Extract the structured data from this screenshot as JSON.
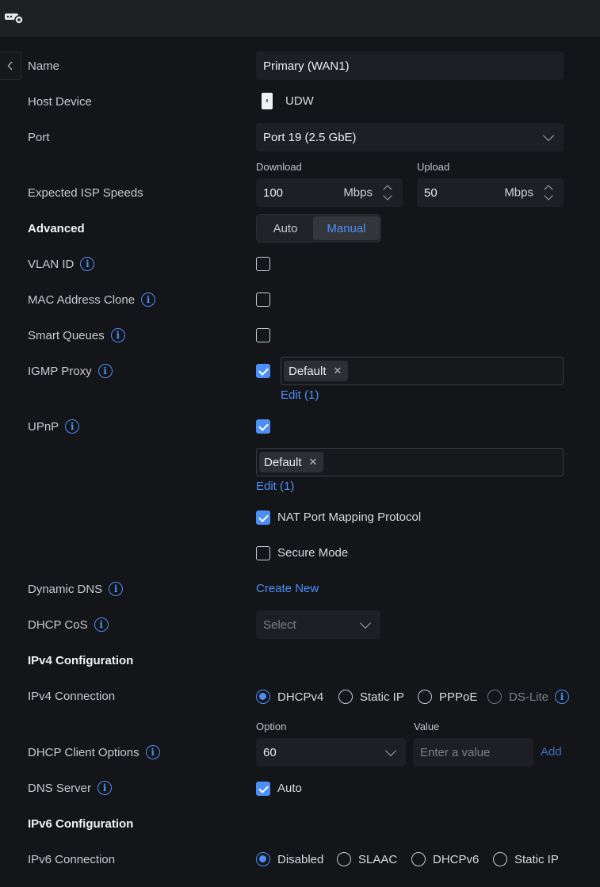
{
  "form": {
    "name": {
      "label": "Name",
      "value": "Primary (WAN1)"
    },
    "host_device": {
      "label": "Host Device",
      "value": "UDW"
    },
    "port": {
      "label": "Port",
      "value": "Port 19 (2.5 GbE)"
    },
    "isp_speeds": {
      "label": "Expected ISP Speeds",
      "download_label": "Download",
      "download_value": "100",
      "download_unit": "Mbps",
      "upload_label": "Upload",
      "upload_value": "50",
      "upload_unit": "Mbps"
    },
    "advanced": {
      "label": "Advanced",
      "options": [
        "Auto",
        "Manual"
      ],
      "selected": "Manual"
    },
    "vlan_id": {
      "label": "VLAN ID",
      "checked": false
    },
    "mac_clone": {
      "label": "MAC Address Clone",
      "checked": false
    },
    "smart_queues": {
      "label": "Smart Queues",
      "checked": false
    },
    "igmp_proxy": {
      "label": "IGMP Proxy",
      "checked": true,
      "tag": "Default",
      "edit_link": "Edit (1)"
    },
    "upnp": {
      "label": "UPnP",
      "checked": true,
      "tag": "Default",
      "edit_link": "Edit (1)",
      "nat_pmp": {
        "label": "NAT Port Mapping Protocol",
        "checked": true
      },
      "secure_mode": {
        "label": "Secure Mode",
        "checked": false
      }
    },
    "dynamic_dns": {
      "label": "Dynamic DNS",
      "action": "Create New"
    },
    "dhcp_cos": {
      "label": "DHCP CoS",
      "placeholder": "Select"
    },
    "ipv4_section": "IPv4 Configuration",
    "ipv4_connection": {
      "label": "IPv4 Connection",
      "options": [
        "DHCPv4",
        "Static IP",
        "PPPoE",
        "DS-Lite"
      ],
      "selected": "DHCPv4"
    },
    "dhcp_client_options": {
      "label": "DHCP Client Options",
      "option_label": "Option",
      "option_value": "60",
      "value_label": "Value",
      "value_placeholder": "Enter a value",
      "add": "Add"
    },
    "dns_server": {
      "label": "DNS Server",
      "checkbox_label": "Auto",
      "checked": true
    },
    "ipv6_section": "IPv6 Configuration",
    "ipv6_connection": {
      "label": "IPv6 Connection",
      "options": [
        "Disabled",
        "SLAAC",
        "DHCPv6",
        "Static IP"
      ],
      "selected": "Disabled"
    }
  },
  "colors": {
    "accent": "#4c8ff7",
    "background": "#141519",
    "field": "#1e1f24"
  }
}
